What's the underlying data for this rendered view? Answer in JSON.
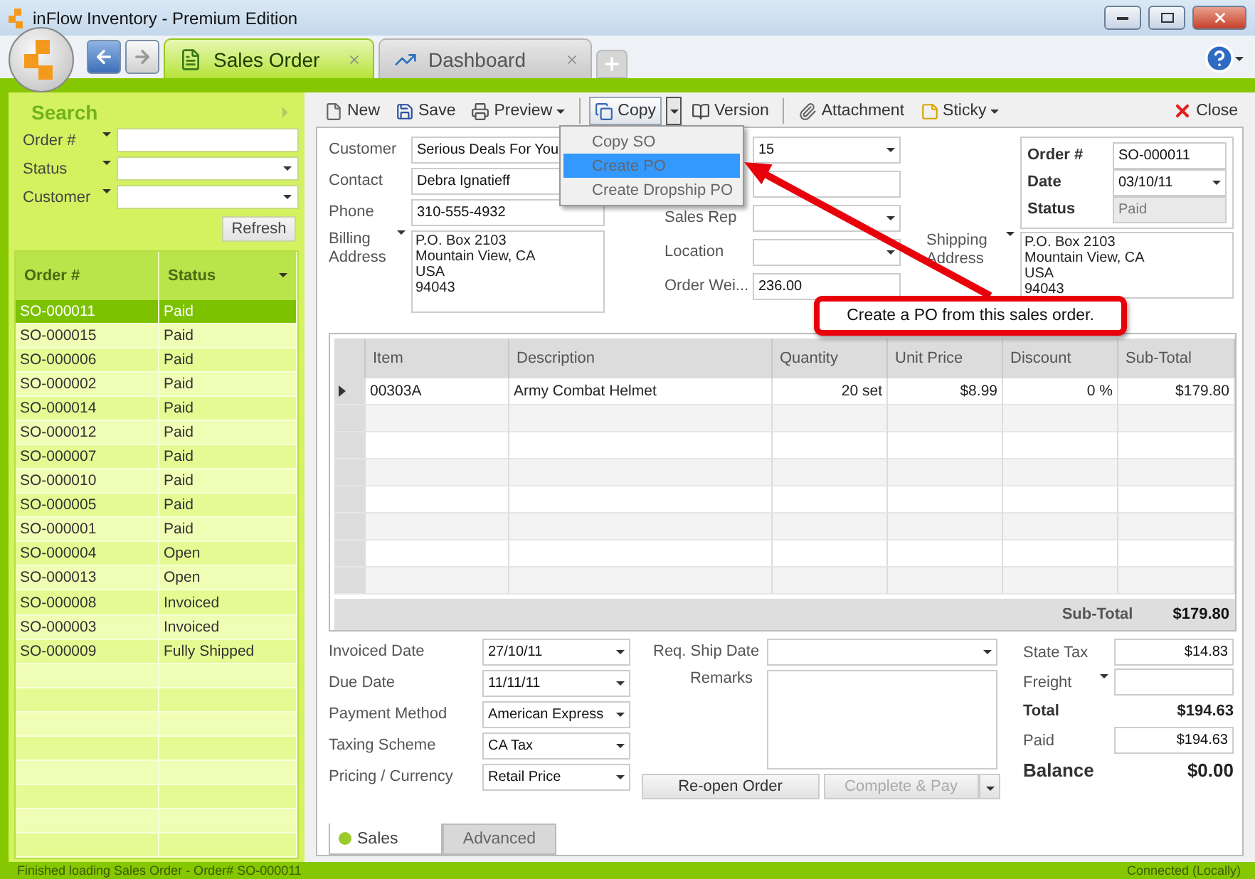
{
  "window": {
    "title": "inFlow Inventory - Premium Edition"
  },
  "tabs": [
    {
      "label": "Sales Order",
      "selected": true
    },
    {
      "label": "Dashboard",
      "selected": false
    }
  ],
  "search": {
    "title": "Search",
    "filters": [
      {
        "label": "Order #",
        "kind": "text"
      },
      {
        "label": "Status",
        "kind": "select"
      },
      {
        "label": "Customer",
        "kind": "select"
      }
    ],
    "refresh_button": "Refresh"
  },
  "order_list": {
    "columns": [
      "Order #",
      "Status"
    ],
    "rows": [
      {
        "order": "SO-000011",
        "status": "Paid",
        "selected": true
      },
      {
        "order": "SO-000015",
        "status": "Paid",
        "selected": false
      },
      {
        "order": "SO-000006",
        "status": "Paid",
        "selected": false
      },
      {
        "order": "SO-000002",
        "status": "Paid",
        "selected": false
      },
      {
        "order": "SO-000014",
        "status": "Paid",
        "selected": false
      },
      {
        "order": "SO-000012",
        "status": "Paid",
        "selected": false
      },
      {
        "order": "SO-000007",
        "status": "Paid",
        "selected": false
      },
      {
        "order": "SO-000010",
        "status": "Paid",
        "selected": false
      },
      {
        "order": "SO-000005",
        "status": "Paid",
        "selected": false
      },
      {
        "order": "SO-000001",
        "status": "Paid",
        "selected": false
      },
      {
        "order": "SO-000004",
        "status": "Open",
        "selected": false
      },
      {
        "order": "SO-000013",
        "status": "Open",
        "selected": false
      },
      {
        "order": "SO-000008",
        "status": "Invoiced",
        "selected": false
      },
      {
        "order": "SO-000003",
        "status": "Invoiced",
        "selected": false
      },
      {
        "order": "SO-000009",
        "status": "Fully Shipped",
        "selected": false
      }
    ]
  },
  "toolbar": {
    "buttons": [
      {
        "label": "New",
        "kind": "plain"
      },
      {
        "label": "Save",
        "kind": "plain"
      },
      {
        "label": "Preview",
        "kind": "menu"
      },
      {
        "label": "Copy",
        "kind": "split",
        "pressed": true
      },
      {
        "label": "Version",
        "kind": "plain"
      },
      {
        "label": "Attachment",
        "kind": "plain"
      },
      {
        "label": "Sticky",
        "kind": "menu"
      }
    ],
    "close": "Close"
  },
  "copy_menu": {
    "items": [
      {
        "label": "Copy SO",
        "selected": false
      },
      {
        "label": "Create PO",
        "selected": true
      },
      {
        "label": "Create Dropship PO",
        "selected": false
      }
    ]
  },
  "callout": {
    "text": "Create a PO from this sales order."
  },
  "customer_fields": [
    {
      "label": "Customer",
      "kind": "text",
      "value": "Serious Deals For You"
    },
    {
      "label": "Contact",
      "kind": "text",
      "value": "Debra Ignatieff"
    },
    {
      "label": "Phone",
      "kind": "text",
      "value": "310-555-4932"
    },
    {
      "label": "Billing Address",
      "kind": "address",
      "lines": [
        "P.O. Box 2103",
        "Mountain View, CA",
        "USA",
        "94043"
      ]
    }
  ],
  "middle_fields": [
    {
      "kind": "select",
      "value": "15"
    },
    {
      "kind": "text"
    },
    {
      "label": "Sales Rep",
      "kind": "select"
    },
    {
      "label": "Location",
      "kind": "select"
    },
    {
      "label": "Order Wei...",
      "kind": "text",
      "value": "236.00"
    }
  ],
  "order_box": [
    {
      "label": "Order #",
      "kind": "text",
      "value": "SO-000011"
    },
    {
      "label": "Date",
      "kind": "select",
      "value": "03/10/11"
    },
    {
      "label": "Status",
      "kind": "readonly",
      "value": "Paid"
    }
  ],
  "shipping": {
    "label": "Shipping Address",
    "lines": [
      "P.O. Box 2103",
      "Mountain View, CA",
      "USA",
      "94043"
    ]
  },
  "items_table": {
    "columns": [
      "Item",
      "Description",
      "Quantity",
      "Unit Price",
      "Discount",
      "Sub-Total"
    ],
    "rows": [
      {
        "current": true,
        "cells": [
          "00303A",
          "Army Combat Helmet",
          "20 set",
          "$8.99",
          "0 %",
          "$179.80"
        ]
      }
    ]
  },
  "subtotal": {
    "label": "Sub-Total",
    "value": "$179.80"
  },
  "details": [
    {
      "label": "Invoiced Date",
      "value": "27/10/11"
    },
    {
      "label": "Due Date",
      "value": "11/11/11"
    },
    {
      "label": "Payment Method",
      "value": "American Express"
    },
    {
      "label": "Taxing Scheme",
      "value": "CA Tax"
    },
    {
      "label": "Pricing / Currency",
      "value": "Retail Price"
    }
  ],
  "req_ship_date": {
    "label": "Req. Ship Date"
  },
  "remarks": {
    "label": "Remarks"
  },
  "actions": [
    {
      "label": "Re-open Order",
      "kind": "plain",
      "disabled": false
    },
    {
      "label": "Complete & Pay",
      "kind": "split",
      "disabled": true
    }
  ],
  "totals": [
    {
      "label": "State Tax",
      "kind": "field",
      "value": "$14.83"
    },
    {
      "label": "Freight",
      "kind": "field-menu"
    },
    {
      "label": "Total",
      "kind": "total",
      "value": "$194.63"
    },
    {
      "label": "Paid",
      "kind": "field",
      "value": "$194.63"
    },
    {
      "label": "Balance",
      "kind": "balance",
      "value": "$0.00"
    }
  ],
  "bottom_tabs": [
    {
      "label": "Sales",
      "selected": true
    },
    {
      "label": "Advanced",
      "selected": false
    }
  ],
  "status_bar": {
    "message": "Finished loading Sales Order - Order# SO-000011",
    "connection": "Connected (Locally)"
  }
}
